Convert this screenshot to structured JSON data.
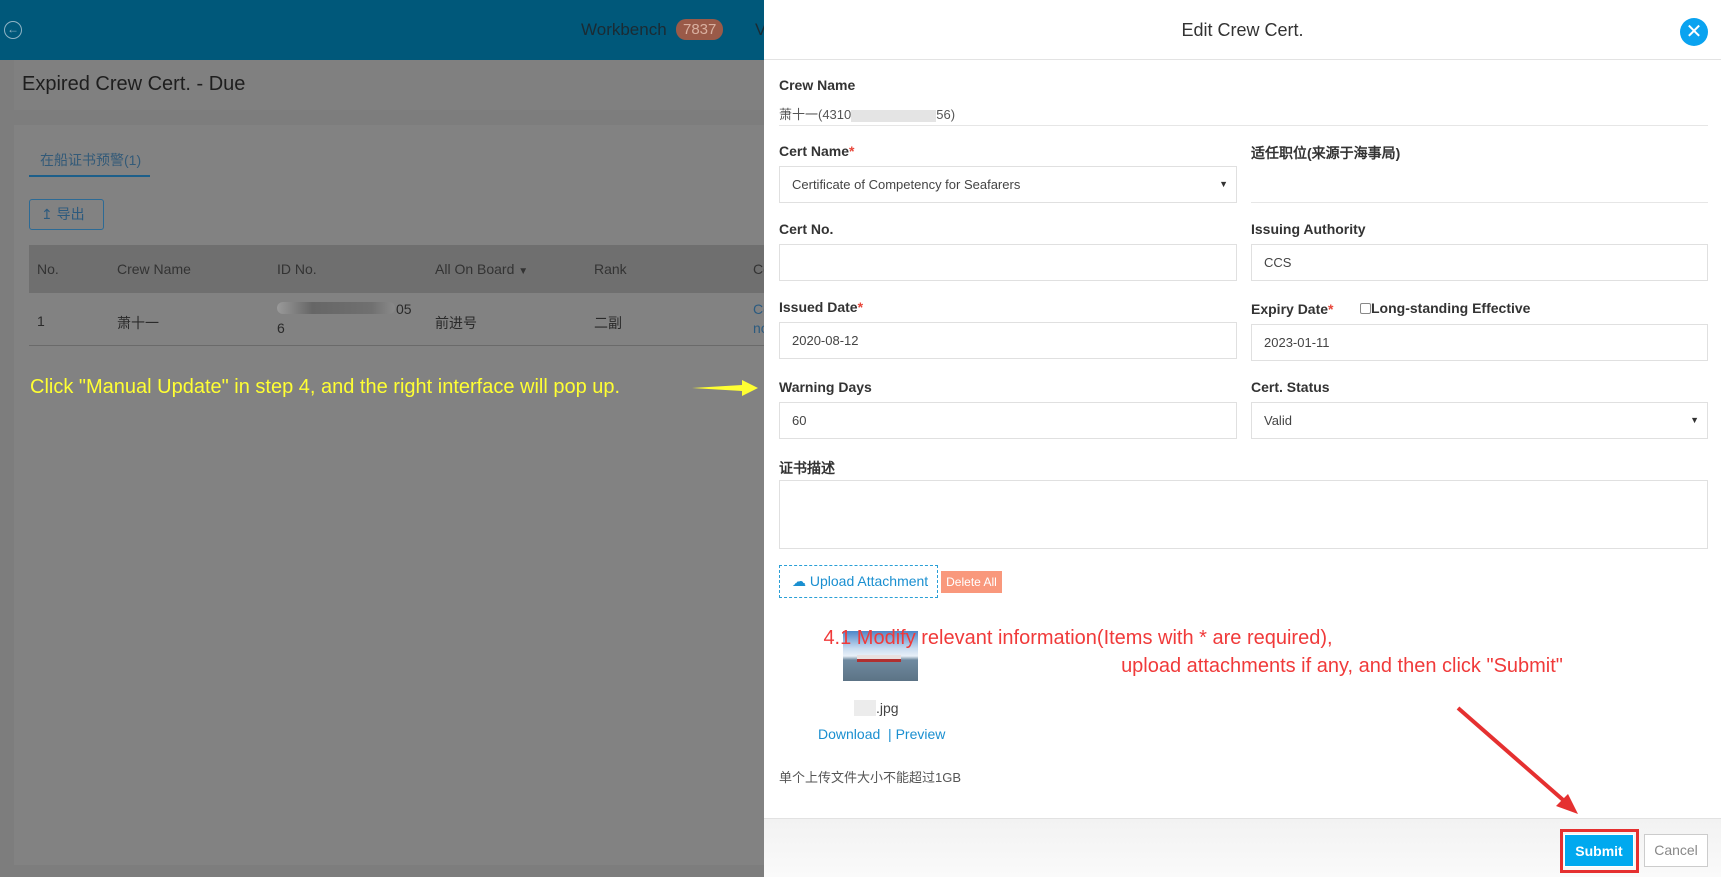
{
  "topbar": {
    "workbench_label": "Workbench",
    "workbench_count": "7837",
    "next_label": "V"
  },
  "page": {
    "title": "Expired Crew Cert. - Due",
    "tab": "在船证书预警(1)",
    "export_label": "导出"
  },
  "table": {
    "headers": [
      "No.",
      "Crew Name",
      "ID No.",
      "All On Board",
      "Rank",
      "Ce"
    ],
    "rows": [
      {
        "no": "1",
        "crew_name": "萧十一",
        "id_tail": "05",
        "id_line2": "6",
        "vessel": "前进号",
        "rank": "二副",
        "cert_1": "Ce",
        "cert_2": "no"
      }
    ]
  },
  "annotation_left": "Click \"Manual Update\" in step 4, and the right interface will pop up.",
  "drawer": {
    "title": "Edit Crew Cert.",
    "crew_name_label": "Crew Name",
    "crew_name_prefix": "萧十一(4310",
    "crew_name_suffix": "56)",
    "cert_name_label": "Cert Name",
    "cert_name_value": "Certificate of Competency for Seafarers",
    "position_label": "适任职位(来源于海事局)",
    "cert_no_label": "Cert No.",
    "cert_no_value": "",
    "issuing_label": "Issuing Authority",
    "issuing_value": "CCS",
    "issued_label": "Issued Date",
    "issued_value": "2020-08-12",
    "expiry_label": "Expiry Date",
    "expiry_value": "2023-01-11",
    "long_standing_label": "Long-standing Effective",
    "warning_label": "Warning Days",
    "warning_value": "60",
    "status_label": "Cert. Status",
    "status_value": "Valid",
    "desc_label": "证书描述",
    "upload_label": "Upload Attachment",
    "delete_all_label": "Delete All",
    "file_ext": ".jpg",
    "download_label": "Download",
    "preview_label": "| Preview",
    "limit_text": "单个上传文件大小不能超过1GB",
    "submit_label": "Submit",
    "cancel_label": "Cancel"
  },
  "annotation_right": {
    "line1": "4.1 Modify relevant information(Items with * are required),",
    "line2": "upload attachments if any, and then click \"Submit\""
  },
  "colors": {
    "accent": "#00a9ef",
    "annotation_red": "#f03a3a",
    "annotation_yellow": "#ffff33",
    "delete": "#f9987c"
  }
}
